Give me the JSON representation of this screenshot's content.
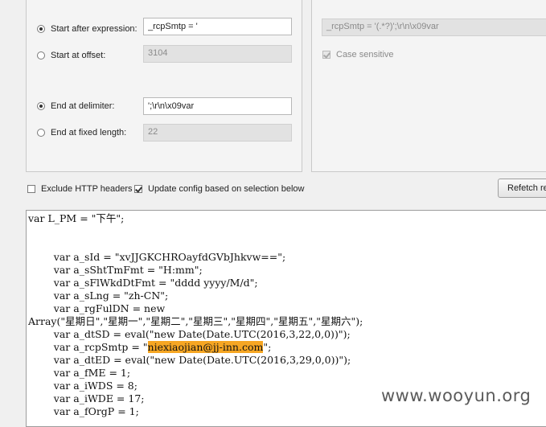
{
  "left_panel": {
    "start_after_label": "Start after expression:",
    "start_after_value": "_rcpSmtp = '",
    "start_offset_label": "Start at offset:",
    "start_offset_value": "3104",
    "end_delim_label": "End at delimiter:",
    "end_delim_value": "';\\r\\n\\x09var",
    "end_fixed_label": "End at fixed length:",
    "end_fixed_value": "22"
  },
  "right_panel": {
    "regex_value": "_rcpSmtp = '(.*?)';\\r\\n\\x09var",
    "case_sensitive_label": "Case sensitive"
  },
  "options": {
    "exclude_headers_label": "Exclude HTTP headers",
    "update_config_label": "Update config based on selection below",
    "refetch_label": "Refetch response"
  },
  "code": {
    "lines": [
      "var L_PM = \"下午\";",
      "",
      "",
      "        var a_sId = \"xvJJGKCHROayfdGVbJhkvw==\";",
      "        var a_sShtTmFmt = \"H:mm\";",
      "        var a_sFlWkdDtFmt = \"dddd yyyy/M/d\";",
      "        var a_sLng = \"zh-CN\";",
      "        var a_rgFulDN = new",
      "Array(\"星期日\",\"星期一\",\"星期二\",\"星期三\",\"星期四\",\"星期五\",\"星期六\");",
      "        var a_dtSD = eval(\"new Date(Date.UTC(2016,3,22,0,0))\");",
      "",
      "        var a_dtED = eval(\"new Date(Date.UTC(2016,3,29,0,0))\");",
      "        var a_fME = 1;",
      "        var a_iWDS = 8;",
      "        var a_iWDE = 17;",
      "        var a_fOrgP = 1;"
    ],
    "smtp_prefix": "        var a_rcpSmtp = \"",
    "smtp_value": "niexiaojian@jj-inn.com",
    "smtp_suffix": "\";"
  },
  "watermark": "www.wooyun.org"
}
